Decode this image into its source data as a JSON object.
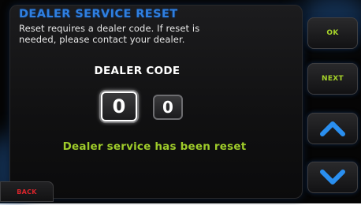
{
  "screen": {
    "title": "DEALER SERVICE RESET",
    "description_line_1": "Reset requires a dealer code. If reset is",
    "description_line_2": "needed, please contact your dealer.",
    "code_heading": "DEALER CODE",
    "digits": [
      "0",
      "0"
    ],
    "status_message": "Dealer service has been reset"
  },
  "side_buttons": {
    "ok_label": "OK",
    "next_label": "NEXT",
    "up_icon": "chevron-up-icon",
    "down_icon": "chevron-down-icon"
  },
  "footer": {
    "back_label": "BACK"
  },
  "colors": {
    "title": "#2f7fe0",
    "status": "#9ecb2a",
    "button_text": "#a7d42a",
    "arrow": "#2a8ff0",
    "back_text": "#d9242b"
  }
}
